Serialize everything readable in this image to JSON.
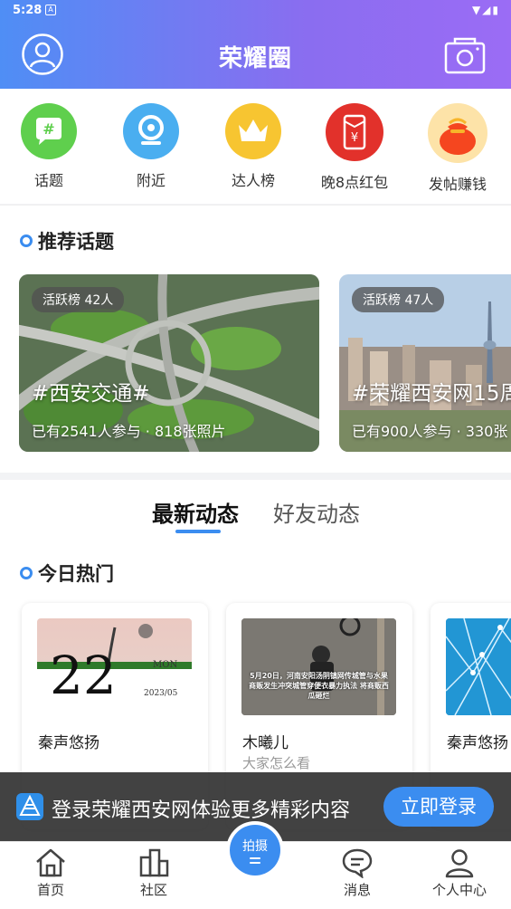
{
  "status_bar": {
    "time": "5:28"
  },
  "header": {
    "title": "荣耀圈"
  },
  "quick_entries": [
    {
      "label": "话题",
      "icon": "hashtag-chat-icon",
      "color": "#5fcf4d"
    },
    {
      "label": "附近",
      "icon": "location-icon",
      "color": "#4aaef0"
    },
    {
      "label": "达人榜",
      "icon": "crown-icon",
      "color": "#f7c531"
    },
    {
      "label": "晚8点红包",
      "icon": "red-envelope-icon",
      "color": "#e2312b"
    },
    {
      "label": "发帖赚钱",
      "icon": "money-bag-icon",
      "color": "#f49a1f"
    }
  ],
  "recommended": {
    "title": "推荐话题",
    "topics": [
      {
        "badge": "活跃榜 42人",
        "title": "#西安交通#",
        "meta": "已有2541人参与 · 818张照片"
      },
      {
        "badge": "活跃榜 47人",
        "title": "#荣耀西安网15周",
        "meta": "已有900人参与 · 330张"
      }
    ]
  },
  "feed_tabs": {
    "active": "最新动态",
    "inactive": "好友动态"
  },
  "hot": {
    "title": "今日热门",
    "cards": [
      {
        "name": "秦声悠扬",
        "sub": "",
        "img_day": "22",
        "img_mon": "MON",
        "img_date": "2023/05"
      },
      {
        "name": "木曦儿",
        "sub": "大家怎么看",
        "img_caption": "5月20日，河南安阳汤阴镇网传城管与水果商贩发生冲突城管穿便衣暴力执法 将商贩西瓜砸烂"
      },
      {
        "name": "秦声悠扬",
        "sub": ""
      }
    ]
  },
  "login_banner": {
    "text": "登录荣耀西安网体验更多精彩内容",
    "button": "立即登录"
  },
  "bottom_nav": {
    "items": [
      {
        "label": "首页",
        "icon": "home-icon"
      },
      {
        "label": "社区",
        "icon": "community-icon"
      },
      {
        "label": "消息",
        "icon": "message-icon"
      },
      {
        "label": "个人中心",
        "icon": "person-icon"
      }
    ],
    "shoot": "拍摄"
  },
  "colors": {
    "accent": "#3b8df0",
    "header_start": "#4f8ef5",
    "header_end": "#9b6cf5"
  }
}
